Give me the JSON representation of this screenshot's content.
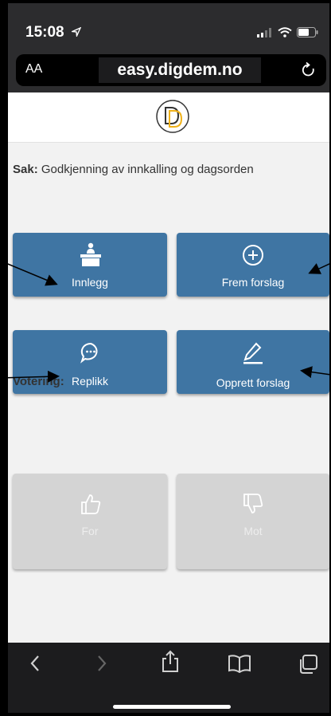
{
  "status_bar": {
    "time": "15:08"
  },
  "url_bar": {
    "text_size_label": "AA",
    "url": "easy.digdem.no"
  },
  "case": {
    "label": "Sak:",
    "title": "Godkjenning av innkalling og dagsorden"
  },
  "actions": {
    "speech": "Innlegg",
    "propose": "Frem forslag",
    "reply": "Replikk",
    "create_proposal": "Opprett forslag"
  },
  "voting": {
    "heading": "Votering:",
    "for": "For",
    "against": "Mot"
  },
  "colors": {
    "action_button": "#3f75a3",
    "vote_button_disabled": "#d4d4d4",
    "logo_accent": "#f0b21a"
  },
  "icons": {
    "speech": "podium-icon",
    "propose": "plus-circle-icon",
    "reply": "chat-bubble-icon",
    "create_proposal": "pencil-icon",
    "for": "thumbs-up-icon",
    "against": "thumbs-down-icon"
  }
}
